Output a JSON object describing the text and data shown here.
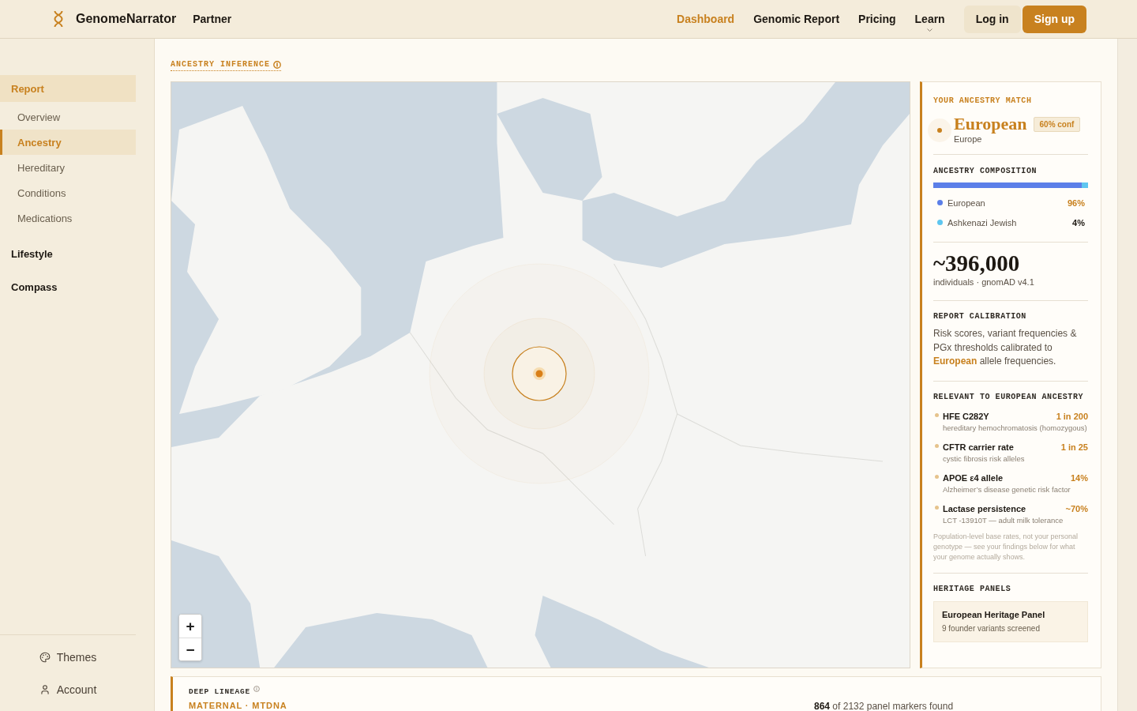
{
  "header": {
    "brand": "GenomeNarrator",
    "partner": "Partner",
    "nav": [
      {
        "label": "Dashboard",
        "selected": true,
        "kind": "link"
      },
      {
        "label": "Genomic Report",
        "selected": false,
        "kind": "link"
      },
      {
        "label": "Pricing",
        "selected": false,
        "kind": "link"
      },
      {
        "label": "Learn",
        "selected": false,
        "kind": "menu"
      }
    ],
    "actions": [
      {
        "label": "Log in",
        "kind": "secondary"
      },
      {
        "label": "Sign up",
        "kind": "primary"
      }
    ]
  },
  "sidebar": {
    "sections": [
      {
        "label": "Report",
        "selected": true,
        "children": [
          {
            "label": "Overview",
            "selected": false
          },
          {
            "label": "Ancestry",
            "selected": true
          },
          {
            "label": "Hereditary",
            "selected": false
          },
          {
            "label": "Conditions",
            "selected": false
          },
          {
            "label": "Medications",
            "selected": false
          }
        ]
      },
      {
        "label": "Lifestyle",
        "selected": false
      },
      {
        "label": "Compass",
        "selected": false
      }
    ],
    "footer": [
      {
        "label": "Themes",
        "kind": "themes"
      },
      {
        "label": "Account",
        "kind": "account"
      }
    ]
  },
  "section_label": "ANCESTRY INFERENCE",
  "map": {
    "zoom_in": "+",
    "zoom_out": "−"
  },
  "match_panel": {
    "label": "YOUR ANCESTRY MATCH",
    "name": "European",
    "region": "Europe",
    "confidence": "60% conf",
    "composition_label": "ANCESTRY COMPOSITION",
    "composition": [
      {
        "name": "European",
        "value": "96%",
        "color": "#5b7fe8",
        "level": 0.96,
        "emphasis": true
      },
      {
        "name": "Ashkenazi Jewish",
        "value": "4%",
        "color": "#5ec6f0",
        "level": 0.04,
        "emphasis": false
      }
    ],
    "stat": {
      "value": "~396,000",
      "caption": "individuals · gnomAD v4.1"
    },
    "calibration": {
      "label": "REPORT CALIBRATION",
      "text": "Risk scores, variant frequencies & PGx thresholds calibrated to **European** allele frequencies."
    },
    "relevant": {
      "label": "RELEVANT TO EUROPEAN ANCESTRY",
      "items": [
        {
          "name": "HFE C282Y",
          "value": "1 in 200",
          "detail": "hereditary hemochromatosis (homozygous)"
        },
        {
          "name": "CFTR carrier rate",
          "value": "1 in 25",
          "detail": "cystic fibrosis risk alleles"
        },
        {
          "name": "APOE ε4 allele",
          "value": "14%",
          "detail": "Alzheimer’s disease genetic risk factor"
        },
        {
          "name": "Lactase persistence",
          "value": "~70%",
          "detail": "LCT -13910T — adult milk tolerance"
        }
      ],
      "note": "Population-level base rates, not your personal genotype — see your findings below for what your genome actually shows."
    },
    "heritage": {
      "label": "HERITAGE PANELS",
      "panels": [
        {
          "name": "European Heritage Panel",
          "detail": "9 founder variants screened"
        }
      ]
    }
  },
  "deep_lineage": {
    "label": "DEEP LINEAGE",
    "lineage": "MATERNAL · MTDNA",
    "markers": "**864** of 2132 panel markers found"
  }
}
